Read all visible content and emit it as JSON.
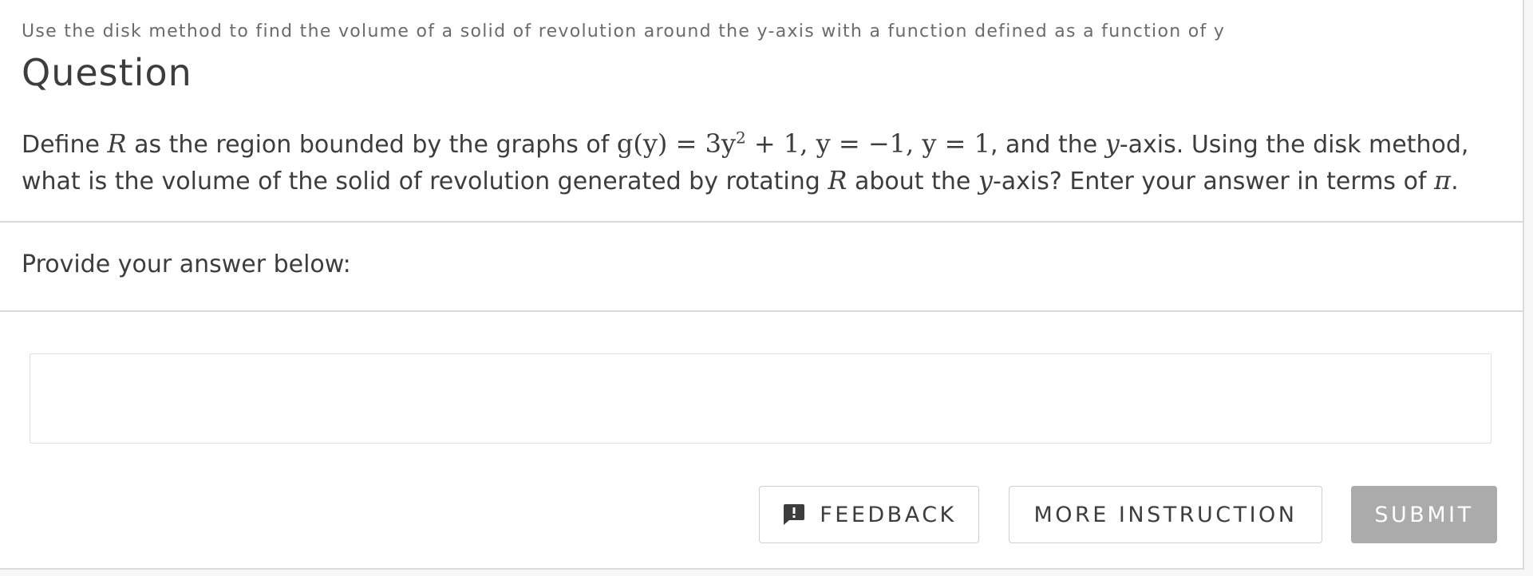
{
  "breadcrumb": "Use the disk method to find the volume of a solid of revolution around the y-axis with a function defined as a function of y",
  "page_title": "Question",
  "question": {
    "line1_text_a": "Define ",
    "var_R": "R",
    "line1_text_b": " as the region bounded by the graphs of ",
    "math_g_of_y": "g(y) = 3y",
    "math_exponent": "2",
    "math_rest": " + 1, y = −1, y = 1",
    "line1_text_c": ", and the ",
    "var_y": "y",
    "line1_text_d": "-axis. Using the disk method,",
    "line2_text_a": "what is the volume of the solid of revolution generated by rotating ",
    "line2_text_b": " about the ",
    "line2_text_c": "-axis? Enter your answer in terms of ",
    "var_pi": "π",
    "line2_text_d": "."
  },
  "answer": {
    "prompt": "Provide your answer below:",
    "value": ""
  },
  "buttons": {
    "feedback_label": "FEEDBACK",
    "feedback_icon": "feedback-icon",
    "more_instruction_label": "MORE INSTRUCTION",
    "submit_label": "SUBMIT"
  },
  "colors": {
    "text": "#3d3d3d",
    "muted": "#6b6b6b",
    "divider": "#d9d9d9",
    "submit_disabled": "#ababab"
  }
}
